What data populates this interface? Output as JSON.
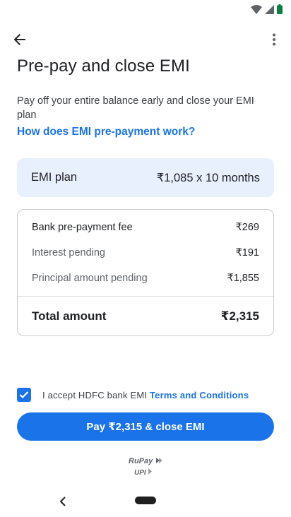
{
  "status_bar": {
    "icons": [
      "wifi-icon",
      "signal-icon",
      "battery-icon"
    ]
  },
  "app_bar": {
    "back_icon": "arrow-back-icon",
    "more_icon": "more-vert-icon"
  },
  "page": {
    "title": "Pre-pay and close EMI",
    "description": "Pay off your entire balance early and close your EMI plan",
    "help_link": "How does EMI pre-payment work?"
  },
  "emi_plan": {
    "label": "EMI plan",
    "value": "₹1,085 x 10 months"
  },
  "breakdown": {
    "rows": [
      {
        "label": "Bank pre-payment fee",
        "value": "₹269"
      },
      {
        "label": "Interest pending",
        "value": "₹191"
      },
      {
        "label": "Principal amount pending",
        "value": "₹1,855"
      }
    ],
    "total": {
      "label": "Total amount",
      "value": "₹2,315"
    }
  },
  "consent": {
    "checked": true,
    "text": "I accept HDFC bank EMI ",
    "link": "Terms and Conditions"
  },
  "pay_button": {
    "label": "Pay ₹2,315 & close EMI"
  },
  "logo": {
    "name": "rupay-upi-logo",
    "text": "RuPay UPI"
  },
  "colors": {
    "accent": "#1a73e8",
    "plan_bg": "#e8f0fe"
  }
}
